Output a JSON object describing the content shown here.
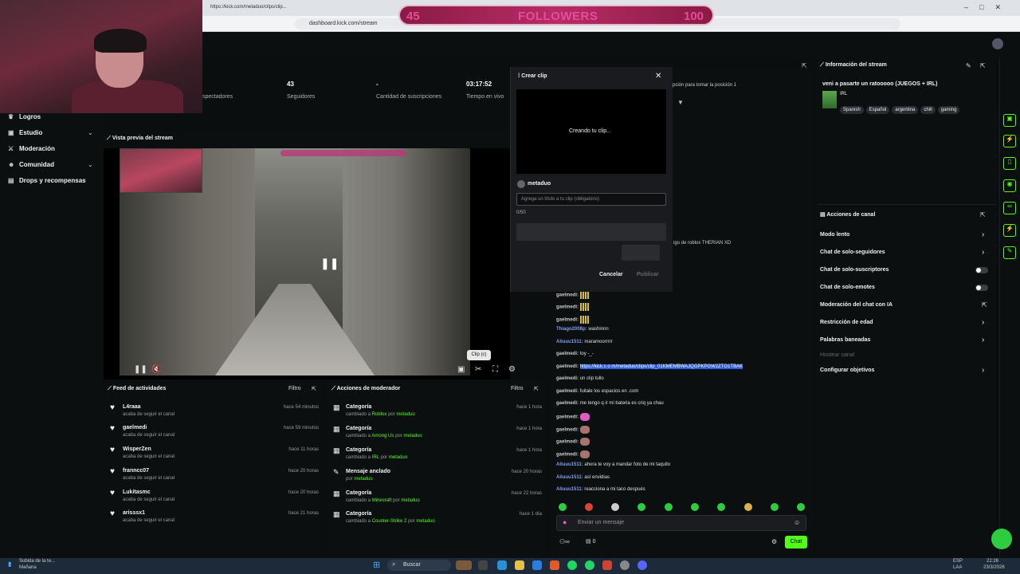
{
  "browser": {
    "tab_title": "https://kick.com/metaduo/clips/clip...",
    "url": "dashboard.kick.com/stream"
  },
  "overlay": {
    "followers_current": "45",
    "followers_label": "FOLLOWERS",
    "followers_goal": "100"
  },
  "nav": {
    "items": [
      {
        "label": "Logros"
      },
      {
        "label": "Estudio"
      },
      {
        "label": "Moderación"
      },
      {
        "label": "Comunidad"
      },
      {
        "label": "Drops y recompensas"
      }
    ]
  },
  "stats": [
    {
      "value": "",
      "label": "spectadores"
    },
    {
      "value": "43",
      "label": "Seguidores"
    },
    {
      "value": "-",
      "label": "Cantidad de suscripciones"
    },
    {
      "value": "03:17:52",
      "label": "Tiempo en vivo"
    }
  ],
  "preview": {
    "title": "Vista previa del stream",
    "clip_tooltip": "Clip (c)"
  },
  "activity": {
    "title": "Feed de actividades",
    "filter": "Filtro",
    "items": [
      {
        "name": "L4raaa",
        "sub": "acaba de seguir el canal",
        "time": "hace 54 minutos"
      },
      {
        "name": "gaelmedi",
        "sub": "acaba de seguir el canal",
        "time": "hace 59 minutos"
      },
      {
        "name": "WisperZen",
        "sub": "acaba de seguir el canal",
        "time": "hace 11 horas"
      },
      {
        "name": "franncc07",
        "sub": "acaba de seguir el canal",
        "time": "hace 20 horas"
      },
      {
        "name": "Lukitasmc",
        "sub": "acaba de seguir el canal",
        "time": "hace 20 horas"
      },
      {
        "name": "arisssx1",
        "sub": "acaba de seguir el canal",
        "time": "hace 21 horas"
      }
    ]
  },
  "modactions": {
    "title": "Acciones de moderador",
    "filter": "Filtro",
    "items": [
      {
        "title": "Categoría",
        "pre": "cambiado a",
        "target": "Roblox",
        "by": "por",
        "user": "metaduo",
        "time": "hace 1 hora"
      },
      {
        "title": "Categoría",
        "pre": "cambiado a",
        "target": "Among Us",
        "by": "por",
        "user": "metaduo",
        "time": "hace 1 hora"
      },
      {
        "title": "Categoría",
        "pre": "cambiado a",
        "target": "IRL",
        "by": "por",
        "user": "metaduo",
        "time": "hace 1 hora"
      },
      {
        "title": "Mensaje anclado",
        "pre": "por",
        "target": "metaduo",
        "by": "",
        "user": "",
        "time": "hace 20 horas"
      },
      {
        "title": "Categoría",
        "pre": "cambiado a",
        "target": "Minecraft",
        "by": "por",
        "user": "metaduo",
        "time": "hace 22 horas"
      },
      {
        "title": "Categoría",
        "pre": "cambiado a",
        "target": "Counter-Strike 2",
        "by": "por",
        "user": "metaduo",
        "time": "hace 1 día"
      }
    ]
  },
  "clip_modal": {
    "title": "Crear clip",
    "creating": "Creando tu clip...",
    "user": "metaduo",
    "placeholder": "Agrega un título a tu clip (obligatorio)",
    "counter": "0/50",
    "cancel": "Cancelar",
    "publish": "Publicar"
  },
  "chat": {
    "partial_top": "pción para tomar la posición 1",
    "partial_mid": "igo de roblox THERIAN XD",
    "lines": [
      {
        "user": "gaelmedi:",
        "text": "",
        "emote": "bars",
        "alt": false
      },
      {
        "user": "gaelmedi:",
        "text": "",
        "emote": "bars",
        "alt": false
      },
      {
        "user": "gaelmedi:",
        "text": "",
        "emote": "bars",
        "alt": false
      },
      {
        "user": "Thiago2008p:",
        "text": "washinnn",
        "emote": "",
        "alt": true
      },
      {
        "user": "Aliuuu1511:",
        "text": "maramoorrrrr",
        "emote": "",
        "alt": true
      },
      {
        "user": "gaelmedi:",
        "text": "toy -_-",
        "emote": "",
        "alt": false
      },
      {
        "user": "gaelmedi:",
        "text": "",
        "emote": "",
        "alt": false,
        "link": "https://kick.c o m/metaduo/clips/clip_01KMEMBWAJQGPKPGW2ZTO1TBAK"
      },
      {
        "user": "gaelmedi:",
        "text": "un clip tullo",
        "emote": "",
        "alt": false
      },
      {
        "user": "gaelmedi:",
        "text": "fuitale los espacios en .com",
        "emote": "",
        "alt": false
      },
      {
        "user": "gaelmedi:",
        "text": "me tengo q ir mi bateria es criq ya chau",
        "emote": "",
        "alt": false
      },
      {
        "user": "gaelmedi:",
        "text": "",
        "emote": "pink",
        "alt": false
      },
      {
        "user": "gaelmedi:",
        "text": "",
        "emote": "skin",
        "alt": false
      },
      {
        "user": "gaelmedi:",
        "text": "",
        "emote": "skin",
        "alt": false
      },
      {
        "user": "gaelmedi:",
        "text": "",
        "emote": "skin",
        "alt": false
      },
      {
        "user": "Aliuuu1511:",
        "text": "ahora te voy a mandar foto de mi taquito",
        "emote": "",
        "alt": true
      },
      {
        "user": "Aliuuu1511:",
        "text": "así envidias",
        "emote": "",
        "alt": true
      },
      {
        "user": "Aliuuu1511:",
        "text": "reacciona a mi taco después",
        "emote": "",
        "alt": true
      }
    ],
    "input_placeholder": "Enviar un mensaje",
    "count": "0",
    "send": "Chat"
  },
  "stream_info": {
    "header": "Información del stream",
    "title": "veni a pasarte un ratooooo (JUEGOS + IRL)",
    "category": "IRL",
    "tags": [
      "Spanish",
      "Español",
      "argentina",
      "chill",
      "gaming"
    ]
  },
  "channel_actions": {
    "header": "Acciones de canal",
    "items": [
      {
        "label": "Modo lento",
        "control": "chevron"
      },
      {
        "label": "Chat de solo-seguidores",
        "control": "chevron"
      },
      {
        "label": "Chat de solo-suscriptores",
        "control": "toggle"
      },
      {
        "label": "Chat de solo-emotes",
        "control": "toggle"
      },
      {
        "label": "Moderación del chat con IA",
        "control": "ext"
      },
      {
        "label": "Restricción de edad",
        "control": "chevron"
      },
      {
        "label": "Palabras baneadas",
        "control": "chevron"
      }
    ],
    "host": "Hostear canal",
    "goals": "Configurar objetivos"
  },
  "taskbar": {
    "weather_line1": "Subida de la te...",
    "weather_line2": "Mañana",
    "search": "Buscar",
    "lang1": "ESP",
    "lang2": "LAA",
    "time": "22:26",
    "date": "23/3/2026"
  },
  "colors": {
    "accent": "#53fc18",
    "overlay_pink": "#e84c9c"
  }
}
